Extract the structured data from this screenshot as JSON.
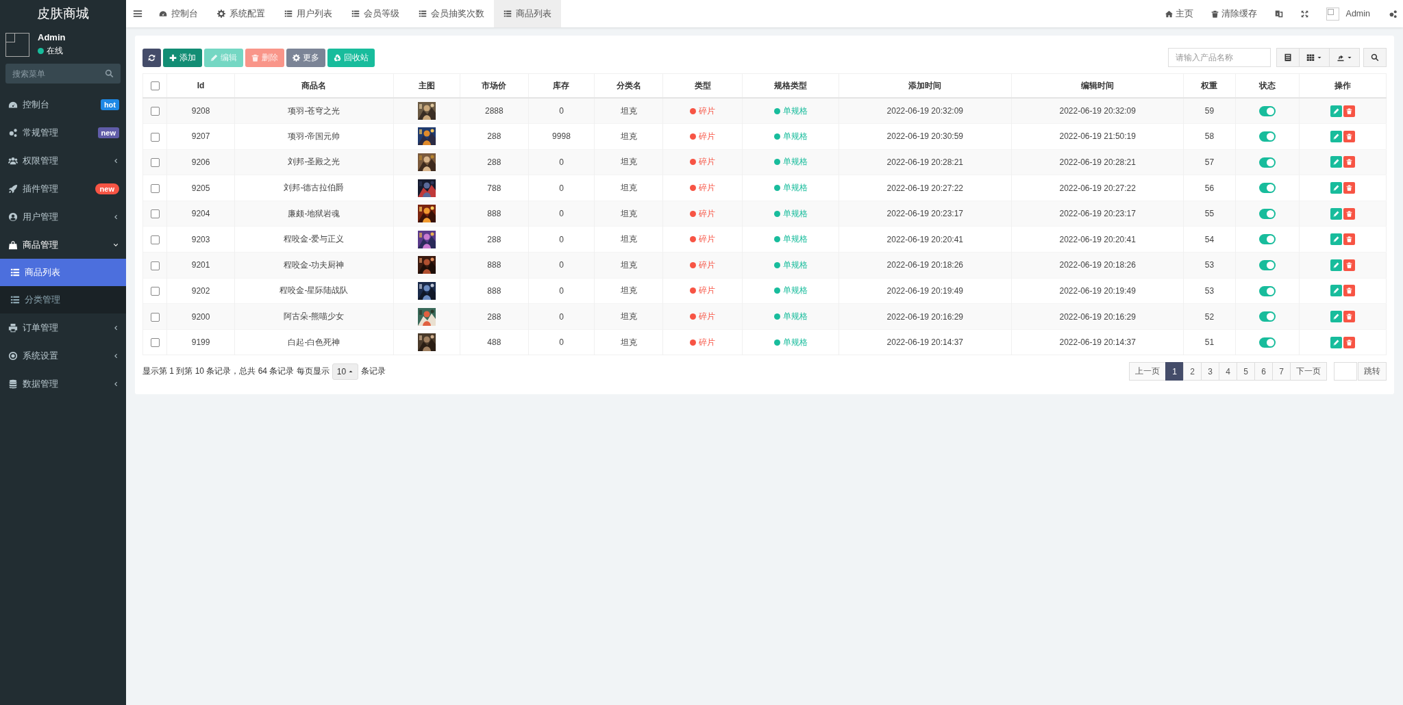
{
  "sidebar": {
    "logo": "皮肤商城",
    "user": {
      "name": "Admin",
      "status": "在线"
    },
    "search": {
      "placeholder": "搜索菜单"
    },
    "items": [
      {
        "label": "控制台",
        "badge": {
          "text": "hot",
          "color": "#1e88e5",
          "kind": "label"
        }
      },
      {
        "label": "常规管理",
        "badge": {
          "text": "new",
          "color": "#605ca8",
          "kind": "label"
        }
      },
      {
        "label": "权限管理",
        "expanded": false
      },
      {
        "label": "插件管理",
        "badge": {
          "text": "new",
          "color": "#f75444",
          "kind": "pill"
        }
      },
      {
        "label": "用户管理",
        "expanded": false
      },
      {
        "label": "商品管理",
        "expanded": true,
        "children": [
          {
            "label": "商品列表",
            "selected": true
          },
          {
            "label": "分类管理",
            "selected": false
          }
        ]
      },
      {
        "label": "订单管理",
        "expanded": false
      },
      {
        "label": "系统设置",
        "expanded": false
      },
      {
        "label": "数据管理",
        "expanded": false
      }
    ]
  },
  "header": {
    "tabs": [
      {
        "label": "控制台",
        "selected": false
      },
      {
        "label": "系统配置",
        "selected": false
      },
      {
        "label": "用户列表",
        "selected": false
      },
      {
        "label": "会员等级",
        "selected": false
      },
      {
        "label": "会员抽奖次数",
        "selected": false
      },
      {
        "label": "商品列表",
        "selected": true
      }
    ],
    "links": [
      "主页",
      "清除缓存"
    ],
    "user": "Admin"
  },
  "toolbar": {
    "buttons": [
      {
        "color": "#444c69",
        "disabled": false
      },
      {
        "label": "添加",
        "color": "#128d74",
        "disabled": false
      },
      {
        "label": "编辑",
        "color": "#74d7c3",
        "disabled": true
      },
      {
        "label": "删除",
        "color": "#f99589",
        "disabled": true
      },
      {
        "label": "更多",
        "color": "#7b8496",
        "disabled": false
      },
      {
        "label": "回收站",
        "color": "#18bc9c",
        "disabled": false
      }
    ],
    "search": {
      "placeholder": "请输入产品名称"
    }
  },
  "table": {
    "select_all": {
      "checked": false
    },
    "columns": [
      "Id",
      "商品名",
      "主图",
      "市场价",
      "库存",
      "分类名",
      "类型",
      "规格类型",
      "添加时间",
      "编辑时间",
      "权重",
      "状态",
      "操作"
    ],
    "rows": [
      {
        "checked": false,
        "id": "9208",
        "name": "项羽-苍穹之光",
        "price": "2888",
        "stock": "0",
        "category": "坦克",
        "type": {
          "text": "碎片",
          "color": "#f75444"
        },
        "spec": {
          "text": "单规格",
          "color": "#18bc9c"
        },
        "added": "2022-06-19 20:32:09",
        "edited": "2022-06-19 20:32:09",
        "weight": "59",
        "on": true
      },
      {
        "checked": false,
        "id": "9207",
        "name": "项羽-帝国元帅",
        "price": "288",
        "stock": "9998",
        "category": "坦克",
        "type": {
          "text": "碎片",
          "color": "#f75444"
        },
        "spec": {
          "text": "单规格",
          "color": "#18bc9c"
        },
        "added": "2022-06-19 20:30:59",
        "edited": "2022-06-19 21:50:19",
        "weight": "58",
        "on": true
      },
      {
        "checked": false,
        "id": "9206",
        "name": "刘邦-圣殿之光",
        "price": "288",
        "stock": "0",
        "category": "坦克",
        "type": {
          "text": "碎片",
          "color": "#f75444"
        },
        "spec": {
          "text": "单规格",
          "color": "#18bc9c"
        },
        "added": "2022-06-19 20:28:21",
        "edited": "2022-06-19 20:28:21",
        "weight": "57",
        "on": true
      },
      {
        "checked": false,
        "id": "9205",
        "name": "刘邦-德古拉伯爵",
        "price": "788",
        "stock": "0",
        "category": "坦克",
        "type": {
          "text": "碎片",
          "color": "#f75444"
        },
        "spec": {
          "text": "单规格",
          "color": "#18bc9c"
        },
        "added": "2022-06-19 20:27:22",
        "edited": "2022-06-19 20:27:22",
        "weight": "56",
        "on": true
      },
      {
        "checked": false,
        "id": "9204",
        "name": "廉颇-地狱岩魂",
        "price": "888",
        "stock": "0",
        "category": "坦克",
        "type": {
          "text": "碎片",
          "color": "#f75444"
        },
        "spec": {
          "text": "单规格",
          "color": "#18bc9c"
        },
        "added": "2022-06-19 20:23:17",
        "edited": "2022-06-19 20:23:17",
        "weight": "55",
        "on": true
      },
      {
        "checked": false,
        "id": "9203",
        "name": "程咬金-爱与正义",
        "price": "288",
        "stock": "0",
        "category": "坦克",
        "type": {
          "text": "碎片",
          "color": "#f75444"
        },
        "spec": {
          "text": "单规格",
          "color": "#18bc9c"
        },
        "added": "2022-06-19 20:20:41",
        "edited": "2022-06-19 20:20:41",
        "weight": "54",
        "on": true
      },
      {
        "checked": false,
        "id": "9201",
        "name": "程咬金-功夫厨神",
        "price": "888",
        "stock": "0",
        "category": "坦克",
        "type": {
          "text": "碎片",
          "color": "#f75444"
        },
        "spec": {
          "text": "单规格",
          "color": "#18bc9c"
        },
        "added": "2022-06-19 20:18:26",
        "edited": "2022-06-19 20:18:26",
        "weight": "53",
        "on": true
      },
      {
        "checked": false,
        "id": "9202",
        "name": "程咬金-星际陆战队",
        "price": "888",
        "stock": "0",
        "category": "坦克",
        "type": {
          "text": "碎片",
          "color": "#f75444"
        },
        "spec": {
          "text": "单规格",
          "color": "#18bc9c"
        },
        "added": "2022-06-19 20:19:49",
        "edited": "2022-06-19 20:19:49",
        "weight": "53",
        "on": true
      },
      {
        "checked": false,
        "id": "9200",
        "name": "阿古朵-熊喵少女",
        "price": "288",
        "stock": "0",
        "category": "坦克",
        "type": {
          "text": "碎片",
          "color": "#f75444"
        },
        "spec": {
          "text": "单规格",
          "color": "#18bc9c"
        },
        "added": "2022-06-19 20:16:29",
        "edited": "2022-06-19 20:16:29",
        "weight": "52",
        "on": true
      },
      {
        "checked": false,
        "id": "9199",
        "name": "白起-白色死神",
        "price": "488",
        "stock": "0",
        "category": "坦克",
        "type": {
          "text": "碎片",
          "color": "#f75444"
        },
        "spec": {
          "text": "单规格",
          "color": "#18bc9c"
        },
        "added": "2022-06-19 20:14:37",
        "edited": "2022-06-19 20:14:37",
        "weight": "51",
        "on": true
      }
    ]
  },
  "pagination": {
    "summary": "显示第 1 到第 10 条记录，总共 64 条记录 每页显示",
    "page_size": "10",
    "summary_end": "条记录",
    "prev": "上一页",
    "pages": [
      {
        "label": "1",
        "selected": true
      },
      {
        "label": "2",
        "selected": false
      },
      {
        "label": "3",
        "selected": false
      },
      {
        "label": "4",
        "selected": false
      },
      {
        "label": "5",
        "selected": false
      },
      {
        "label": "6",
        "selected": false
      },
      {
        "label": "7",
        "selected": false
      }
    ],
    "next": "下一页",
    "jump": "跳转"
  }
}
